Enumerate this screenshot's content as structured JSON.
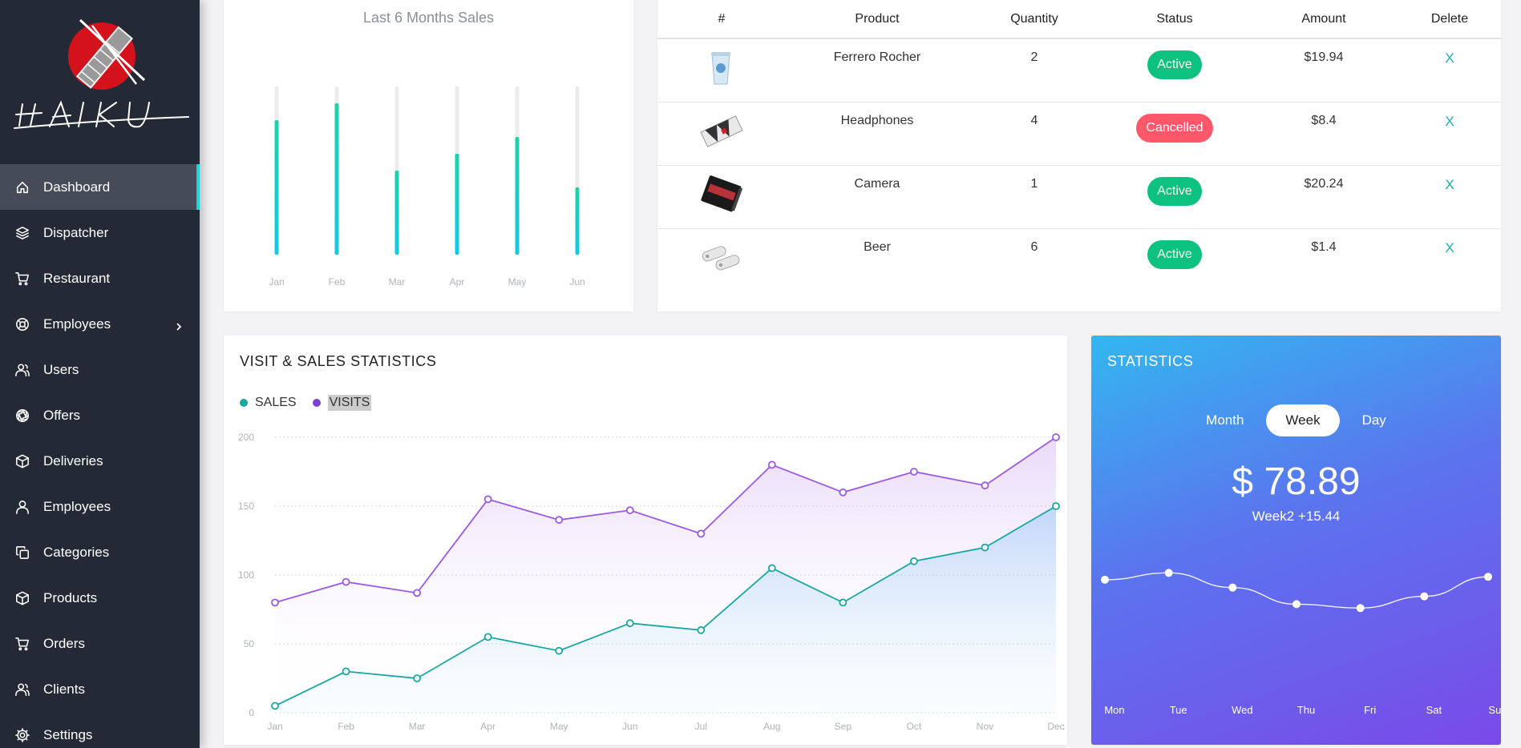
{
  "brand": {
    "logo_text": "HAIKU"
  },
  "sidebar": {
    "items": [
      {
        "label": "Dashboard",
        "icon": "home-icon",
        "active": true
      },
      {
        "label": "Dispatcher",
        "icon": "layers-icon"
      },
      {
        "label": "Restaurant",
        "icon": "cart-icon"
      },
      {
        "label": "Employees",
        "icon": "lifebuoy-icon",
        "has_submenu": true
      },
      {
        "label": "Users",
        "icon": "users-icon"
      },
      {
        "label": "Offers",
        "icon": "aperture-icon"
      },
      {
        "label": "Deliveries",
        "icon": "box-icon"
      },
      {
        "label": "Employees",
        "icon": "user-icon"
      },
      {
        "label": "Categories",
        "icon": "copy-icon"
      },
      {
        "label": "Products",
        "icon": "box-icon"
      },
      {
        "label": "Orders",
        "icon": "cart-icon"
      },
      {
        "label": "Clients",
        "icon": "users-icon"
      },
      {
        "label": "Settings",
        "icon": "gear-icon"
      }
    ]
  },
  "sales_card": {
    "title": "Last 6 Months Sales",
    "chart_data": {
      "type": "bar",
      "categories": [
        "Jan",
        "Feb",
        "Mar",
        "Apr",
        "May",
        "Jun"
      ],
      "values": [
        80,
        90,
        50,
        60,
        70,
        40
      ],
      "ylim": [
        0,
        100
      ],
      "colors": {
        "fill_top": "#1fd1a9",
        "fill_bottom": "#14c8e6",
        "track": "#ececec"
      }
    }
  },
  "orders_table": {
    "headers": [
      "#",
      "Product",
      "Quantity",
      "Status",
      "Amount",
      "Delete"
    ],
    "rows": [
      {
        "thumb": "cup-image",
        "product": "Ferrero Rocher",
        "quantity": "2",
        "status": "Active",
        "amount": "$19.94",
        "delete": "X"
      },
      {
        "thumb": "headphones-image",
        "product": "Headphones",
        "quantity": "4",
        "status": "Cancelled",
        "amount": "$8.4",
        "delete": "X"
      },
      {
        "thumb": "notebook-image",
        "product": "Camera",
        "quantity": "1",
        "status": "Active",
        "amount": "$20.24",
        "delete": "X"
      },
      {
        "thumb": "usb-image",
        "product": "Beer",
        "quantity": "6",
        "status": "Active",
        "amount": "$1.4",
        "delete": "X"
      }
    ]
  },
  "visits_card": {
    "title": "VISIT & SALES STATISTICS",
    "legend": [
      {
        "name": "SALES",
        "color": "#1aa7a0"
      },
      {
        "name": "VISITS",
        "color": "#7c3fd1"
      }
    ],
    "chart_data": {
      "type": "area",
      "categories": [
        "Jan",
        "Feb",
        "Mar",
        "Apr",
        "May",
        "Jun",
        "Jul",
        "Aug",
        "Sep",
        "Oct",
        "Nov",
        "Dec"
      ],
      "yticks": [
        0,
        50,
        100,
        150,
        200
      ],
      "ylim": [
        0,
        200
      ],
      "grid": true,
      "series": [
        {
          "name": "SALES",
          "color": "#1aa7a0",
          "values": [
            5,
            30,
            25,
            55,
            45,
            65,
            60,
            105,
            80,
            110,
            120,
            150
          ]
        },
        {
          "name": "VISITS",
          "color": "#9b59e6",
          "values": [
            80,
            95,
            87,
            155,
            140,
            147,
            130,
            180,
            160,
            175,
            165,
            200
          ]
        }
      ]
    }
  },
  "stats_card": {
    "title": "STATISTICS",
    "tabs": [
      "Month",
      "Week",
      "Day"
    ],
    "selected_tab": "Week",
    "amount": "$ 78.89",
    "subtitle": "Week2 +15.44",
    "chart_data": {
      "type": "line",
      "categories": [
        "Mon",
        "Tue",
        "Wed",
        "Thu",
        "Fri",
        "Sat",
        "Sun"
      ],
      "values": [
        55,
        62,
        47,
        30,
        26,
        38,
        58
      ],
      "ylim": [
        0,
        100
      ]
    }
  }
}
